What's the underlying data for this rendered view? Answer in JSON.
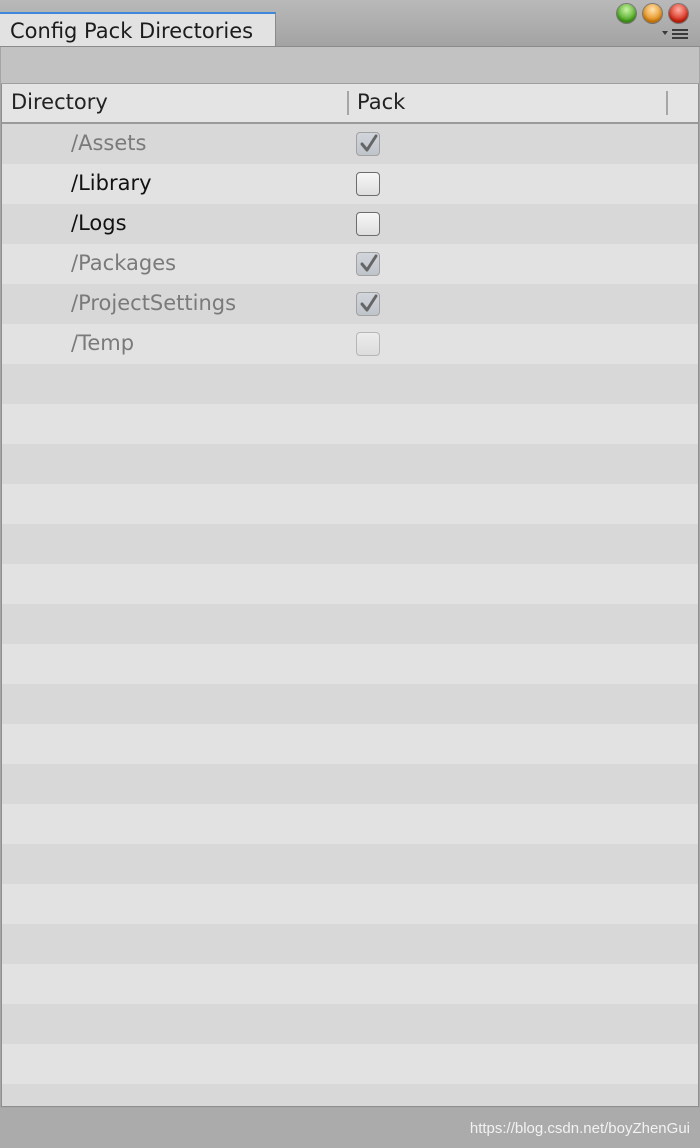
{
  "window": {
    "tab_title": "Config Pack Directories"
  },
  "table": {
    "columns": [
      "Directory",
      "Pack"
    ],
    "rows": [
      {
        "directory": "/Assets",
        "pack": true,
        "enabled": false
      },
      {
        "directory": "/Library",
        "pack": false,
        "enabled": true
      },
      {
        "directory": "/Logs",
        "pack": false,
        "enabled": true
      },
      {
        "directory": "/Packages",
        "pack": true,
        "enabled": false
      },
      {
        "directory": "/ProjectSettings",
        "pack": true,
        "enabled": false
      },
      {
        "directory": "/Temp",
        "pack": false,
        "enabled": false
      }
    ]
  },
  "footer": {
    "watermark": "https://blog.csdn.net/boyZhenGui"
  },
  "icons": {
    "checkmark": "checkmark-icon",
    "menu": "menu-icon"
  }
}
